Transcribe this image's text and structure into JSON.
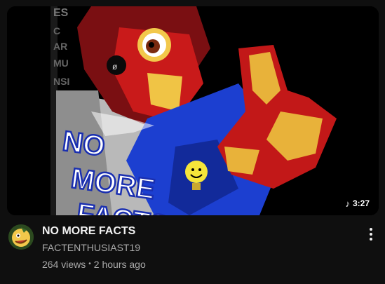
{
  "video": {
    "title": "NO MORE FACTS",
    "channel": "FACTENTHUSIAST19",
    "views": "264 views",
    "separator": "•",
    "age": "2 hours ago",
    "duration": "3:27",
    "duration_icon": "music-note-icon",
    "thumbnail_text": [
      "NO",
      "MORE",
      "FACTS"
    ]
  },
  "colors": {
    "background": "#0f0f0f",
    "title": "#f1f1f1",
    "secondary": "#aaaaaa",
    "thumb_red": "#d81c1c",
    "thumb_blue": "#1c3fd0",
    "thumb_yellow": "#f2c84b"
  }
}
